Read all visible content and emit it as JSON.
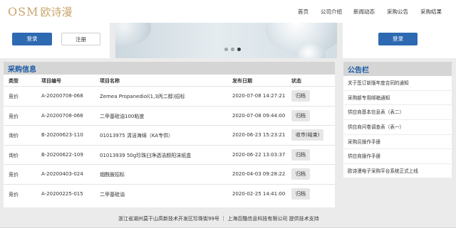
{
  "header": {
    "logo_en": "OSM",
    "logo_cn": "欧诗漫",
    "nav": [
      "首页",
      "公司介绍",
      "新闻动态",
      "采购公告",
      "采购结果"
    ]
  },
  "login": {
    "login_label": "登录",
    "register_label": "注册"
  },
  "right_box": {
    "login_label": "登录"
  },
  "banner": {
    "slides": 3,
    "active_slide": 3
  },
  "procurement": {
    "title": "采购信息",
    "columns": [
      "类型",
      "项目编号",
      "项目名称",
      "发布日期",
      "状态"
    ],
    "rows": [
      [
        "竞价",
        "A-20200708-068",
        "Zemea Propanediol(1,3丙二醇)招标",
        "2020-07-08 14:27:21",
        "归档"
      ],
      [
        "竞价",
        "A-20200708-066",
        "二甲基硅油100粘度",
        "2020-07-08 09:44:00",
        "归档"
      ],
      [
        "询价",
        "B-20200623-110",
        "01013975 清洁海绵（KA专供）",
        "2020-06-23 15:23:21",
        "收市(结束)"
      ],
      [
        "询价",
        "B-20200622-109",
        "01013939 50g珍珠臼净透洁颜阳沫纸盒",
        "2020-06-22 13:03:37",
        "归档"
      ],
      [
        "竞价",
        "A-20200403-024",
        "烟酰胺招标",
        "2020-04-03 09:28:22",
        "归档"
      ],
      [
        "竞价",
        "A-20200225-015",
        "二甲基硅油",
        "2020-02-25 14:41:00",
        "归档"
      ]
    ]
  },
  "announcements": {
    "title": "公告栏",
    "items": [
      "关于签订新版年度合同的通知",
      "采购部专用邮箱通知",
      "供应商基本信息表（表二）",
      "供应商问卷调查表（表一）",
      "采购员操作手册",
      "供应商操作手册",
      "欧诗漫电子采购平台系统正式上线"
    ]
  },
  "footer": {
    "text": "浙江省湖州莫干山高新技术开发区珍珠街99号 ｜ 上海百酷信息科技有限公司 提供技术支持"
  },
  "colors": {
    "accent": "#2d6ab1",
    "title_blue": "#1a5aa5",
    "logo_gold": "#c9a46a",
    "panel_head": "#d5d5d5"
  }
}
